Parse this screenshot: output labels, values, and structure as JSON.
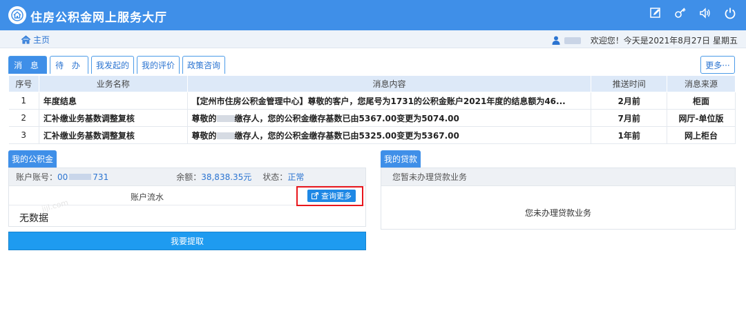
{
  "header": {
    "title": "住房公积金网上服务大厅",
    "icons": [
      "edit-icon",
      "key-icon",
      "volume-icon",
      "power-icon"
    ]
  },
  "subbar": {
    "home": "主页",
    "welcome": "欢迎您！今天是2021年8月27日 星期五"
  },
  "tabs": [
    "消 息",
    "待 办",
    "我发起的",
    "我的评价",
    "政策咨询"
  ],
  "more_label": "更多···",
  "table": {
    "headers": [
      "序号",
      "业务名称",
      "消息内容",
      "推送时间",
      "消息来源"
    ],
    "rows": [
      {
        "no": "1",
        "name": "年度结息",
        "content_a": "【定州市住房公积金管理中心】尊敬的客户，您尾号为1731的公积金账户2021年度的结息额为46...",
        "content_b": "",
        "time": "2月前",
        "source": "柜面"
      },
      {
        "no": "2",
        "name": "汇补缴业务基数调整复核",
        "content_a": "尊敬的",
        "content_b": "缴存人，您的公积金缴存基数已由5367.00变更为5074.00",
        "time": "7月前",
        "source": "网厅-单位版"
      },
      {
        "no": "3",
        "name": "汇补缴业务基数调整复核",
        "content_a": "尊敬的",
        "content_b": "缴存人，您的公积金缴存基数已由5325.00变更为5367.00",
        "time": "1年前",
        "source": "网上柜台"
      }
    ]
  },
  "fund": {
    "tag": "我的公积金",
    "account_label": "账户账号：",
    "account_prefix": "00",
    "account_suffix": "731",
    "balance_label": "余额：",
    "balance": "38,838.35元",
    "status_label": "状态：",
    "status": "正常",
    "flow_label": "账户流水",
    "query_more": "查询更多",
    "no_data": "无数据",
    "withdraw": "我要提取"
  },
  "loan": {
    "tag": "我的贷款",
    "header": "您暂未办理贷款业务",
    "body": "您未办理贷款业务"
  },
  "colors": {
    "primary": "#3f8fe8",
    "highlight": "#e8151b"
  }
}
